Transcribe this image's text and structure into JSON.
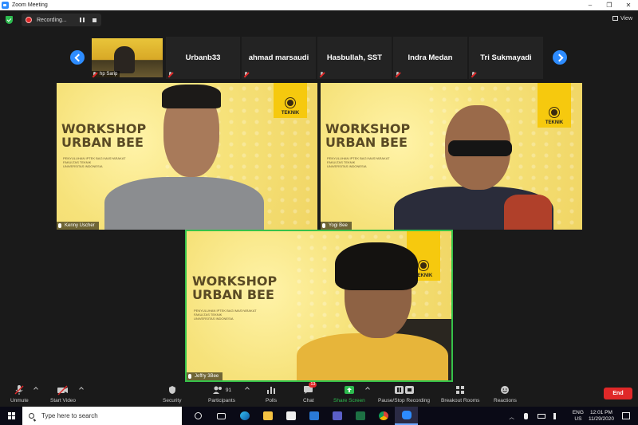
{
  "window": {
    "title": "Zoom Meeting",
    "controls": [
      "–",
      "❐",
      "✕"
    ]
  },
  "recording": {
    "label": "Recording..."
  },
  "view_button": {
    "label": "View"
  },
  "filmstrip": {
    "video_participant": {
      "name": "hp Sarip"
    },
    "names": [
      "Urbanb33",
      "ahmad marsaudi",
      "Hasbullah, SST",
      "Indra Medan",
      "Tri Sukmayadi"
    ]
  },
  "tiles": [
    {
      "name": "Kenny Uscher",
      "title_line1": "WORKSHOP",
      "title_line2": "URBAN BEE",
      "subtitle": [
        "PENYULUHAN IPTEK BAGI MASYARAKAT",
        "FAKULTAS TEKNIK",
        "UNIVERSITAS INDONESIA"
      ],
      "badge": "TEKNIK"
    },
    {
      "name": "Yogi Bee",
      "title_line1": "WORKSHOP",
      "title_line2": "URBAN BEE",
      "subtitle": [
        "PENYULUHAN IPTEK BAGI MASYARAKAT",
        "FAKULTAS TEKNIK",
        "UNIVERSITAS INDONESIA"
      ],
      "badge": "TEKNIK"
    },
    {
      "name": "Jeffry 3Bee",
      "title_line1": "WORKSHOP",
      "title_line2": "URBAN BEE",
      "subtitle": [
        "PENYULUHAN IPTEK BAGI MASYARAKAT",
        "FAKULTAS TEKNIK",
        "UNIVERSITAS INDONESIA"
      ],
      "badge": "TEKNIK"
    }
  ],
  "toolbar": {
    "unmute": "Unmute",
    "start_video": "Start Video",
    "security": "Security",
    "participants": "Participants",
    "participants_count": "91",
    "polls": "Polls",
    "chat": "Chat",
    "chat_badge": "13",
    "share_screen": "Share Screen",
    "recording": "Pause/Stop Recording",
    "breakout": "Breakout Rooms",
    "reactions": "Reactions",
    "end": "End"
  },
  "taskbar": {
    "search_placeholder": "Type here to search",
    "lang_line1": "ENG",
    "lang_line2": "US",
    "time": "12:01 PM",
    "date": "11/29/2020"
  },
  "colors": {
    "accent": "#2d8cff",
    "end": "#e02828",
    "active_speaker": "#36c24a",
    "bg": "#1a1a1a",
    "brand_yellow": "#f6c90e"
  }
}
